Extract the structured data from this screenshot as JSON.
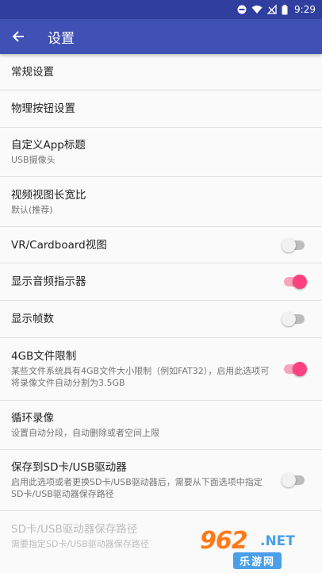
{
  "status": {
    "time": "9:29"
  },
  "header": {
    "title": "设置"
  },
  "settings": [
    {
      "title": "常规设置"
    },
    {
      "title": "物理按钮设置"
    },
    {
      "title": "自定义App标题",
      "subtitle": "USB摄像头"
    },
    {
      "title": "视频视图长宽比",
      "subtitle": "默认(推荐)"
    },
    {
      "title": "VR/Cardboard视图",
      "toggle": false
    },
    {
      "title": "显示音频指示器",
      "toggle": true
    },
    {
      "title": "显示帧数",
      "toggle": false
    },
    {
      "title": "4GB文件限制",
      "subtitle": "某些文件系统具有4GB文件大小限制（例如FAT32），启用此选项可将录像文件自动分割为3.5GB",
      "toggle": true
    },
    {
      "title": "循环录像",
      "subtitle": "设置自动分段，自动删除或者空间上限"
    },
    {
      "title": "保存到SD卡/USB驱动器",
      "subtitle": "启用此选项或者更换SD卡/USB驱动器后，需要从下面选项中指定SD卡/USB驱动器保存路径",
      "toggle": false
    },
    {
      "title": "SD卡/USB驱动器保存路径",
      "subtitle": "需要指定SD卡/USB驱动器保存路径",
      "disabled": true
    }
  ],
  "watermark": {
    "number": "962",
    "net": ".NET",
    "cn": "乐游网"
  },
  "colors": {
    "primary": "#3f51b5",
    "primary_dark": "#303f9f",
    "accent": "#ff4081"
  }
}
